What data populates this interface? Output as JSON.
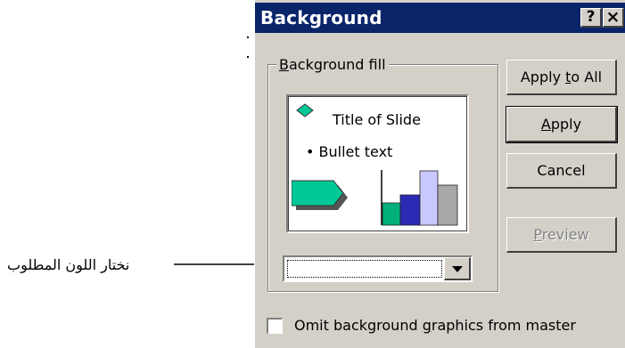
{
  "annotation": {
    "text": "نختار اللون المطلوب"
  },
  "dialog": {
    "title": "Background",
    "help_label": "?",
    "close_label": "×",
    "group_label_prefix": "",
    "group_label_access": "B",
    "group_label_rest": "ackground fill",
    "preview": {
      "title_text": "Title of Slide",
      "bullet_text": "•  Bullet text",
      "colors": {
        "accent": "#00c896",
        "shadow": "#555555",
        "bar1": "#00b07a",
        "bar2": "#2a2ab5",
        "bar3": "#c8c8ff",
        "bar4": "#a8a8a8"
      }
    },
    "combo": {
      "value": ""
    },
    "buttons": {
      "apply_all_pre": "Apply ",
      "apply_all_access": "t",
      "apply_all_post": "o All",
      "apply_access": "A",
      "apply_rest": "pply",
      "cancel": "Cancel",
      "preview_access": "P",
      "preview_rest": "review"
    },
    "checkbox": {
      "pre": "Omit background ",
      "access": "g",
      "post": "raphics from master",
      "checked": false
    }
  }
}
